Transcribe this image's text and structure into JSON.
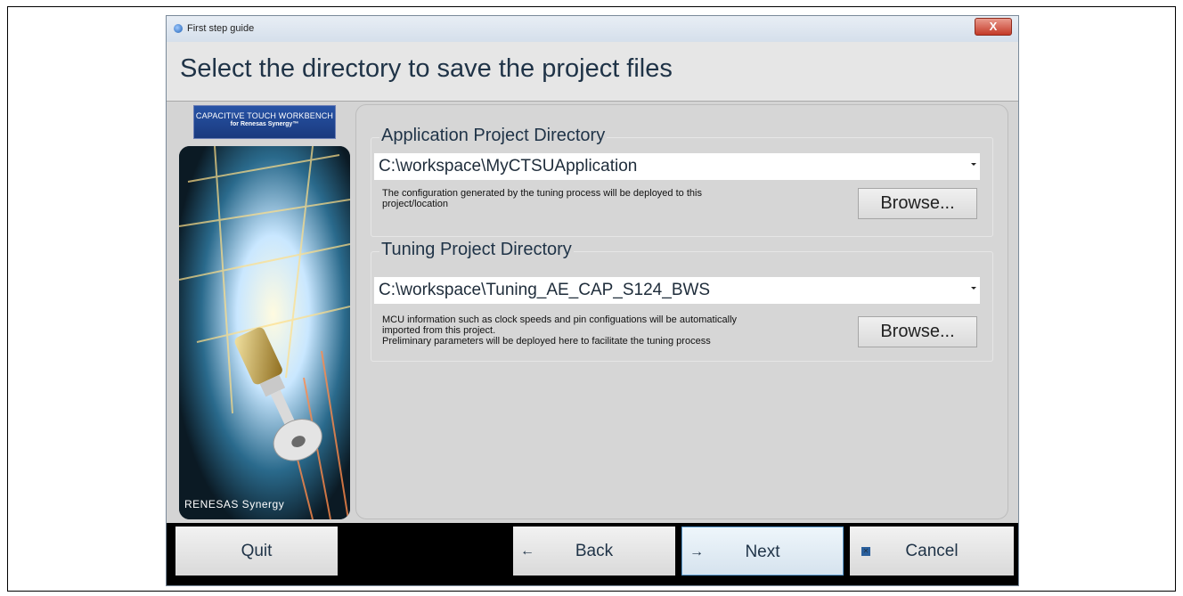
{
  "window": {
    "title": "First step guide",
    "close_label": "X"
  },
  "header": {
    "title": "Select the directory to save the project files"
  },
  "sidebar": {
    "brand_line1": "CAPACITIVE TOUCH WORKBENCH",
    "brand_line2": "for Renesas Synergy™",
    "logo_text": "RENESAS Synergy"
  },
  "application_group": {
    "title": "Application Project Directory",
    "path": "C:\\workspace\\MyCTSUApplication",
    "desc_line1": "The configuration generated by the tuning process will be deployed to this",
    "desc_line2": "project/location",
    "browse_label": "Browse..."
  },
  "tuning_group": {
    "title": "Tuning Project Directory",
    "path": "C:\\workspace\\Tuning_AE_CAP_S124_BWS",
    "desc_line1": "MCU information such as clock speeds and pin configuations will be automatically",
    "desc_line2": "imported from this project.",
    "desc_line3": "Preliminary parameters will be deployed here to facilitate the tuning process",
    "browse_label": "Browse..."
  },
  "footer": {
    "quit_label": "Quit",
    "back_label": "Back",
    "next_label": "Next",
    "cancel_label": "Cancel"
  },
  "icons": {
    "back": "left-arrow-icon",
    "next": "right-arrow-icon",
    "cancel": "cancel-x-icon"
  }
}
